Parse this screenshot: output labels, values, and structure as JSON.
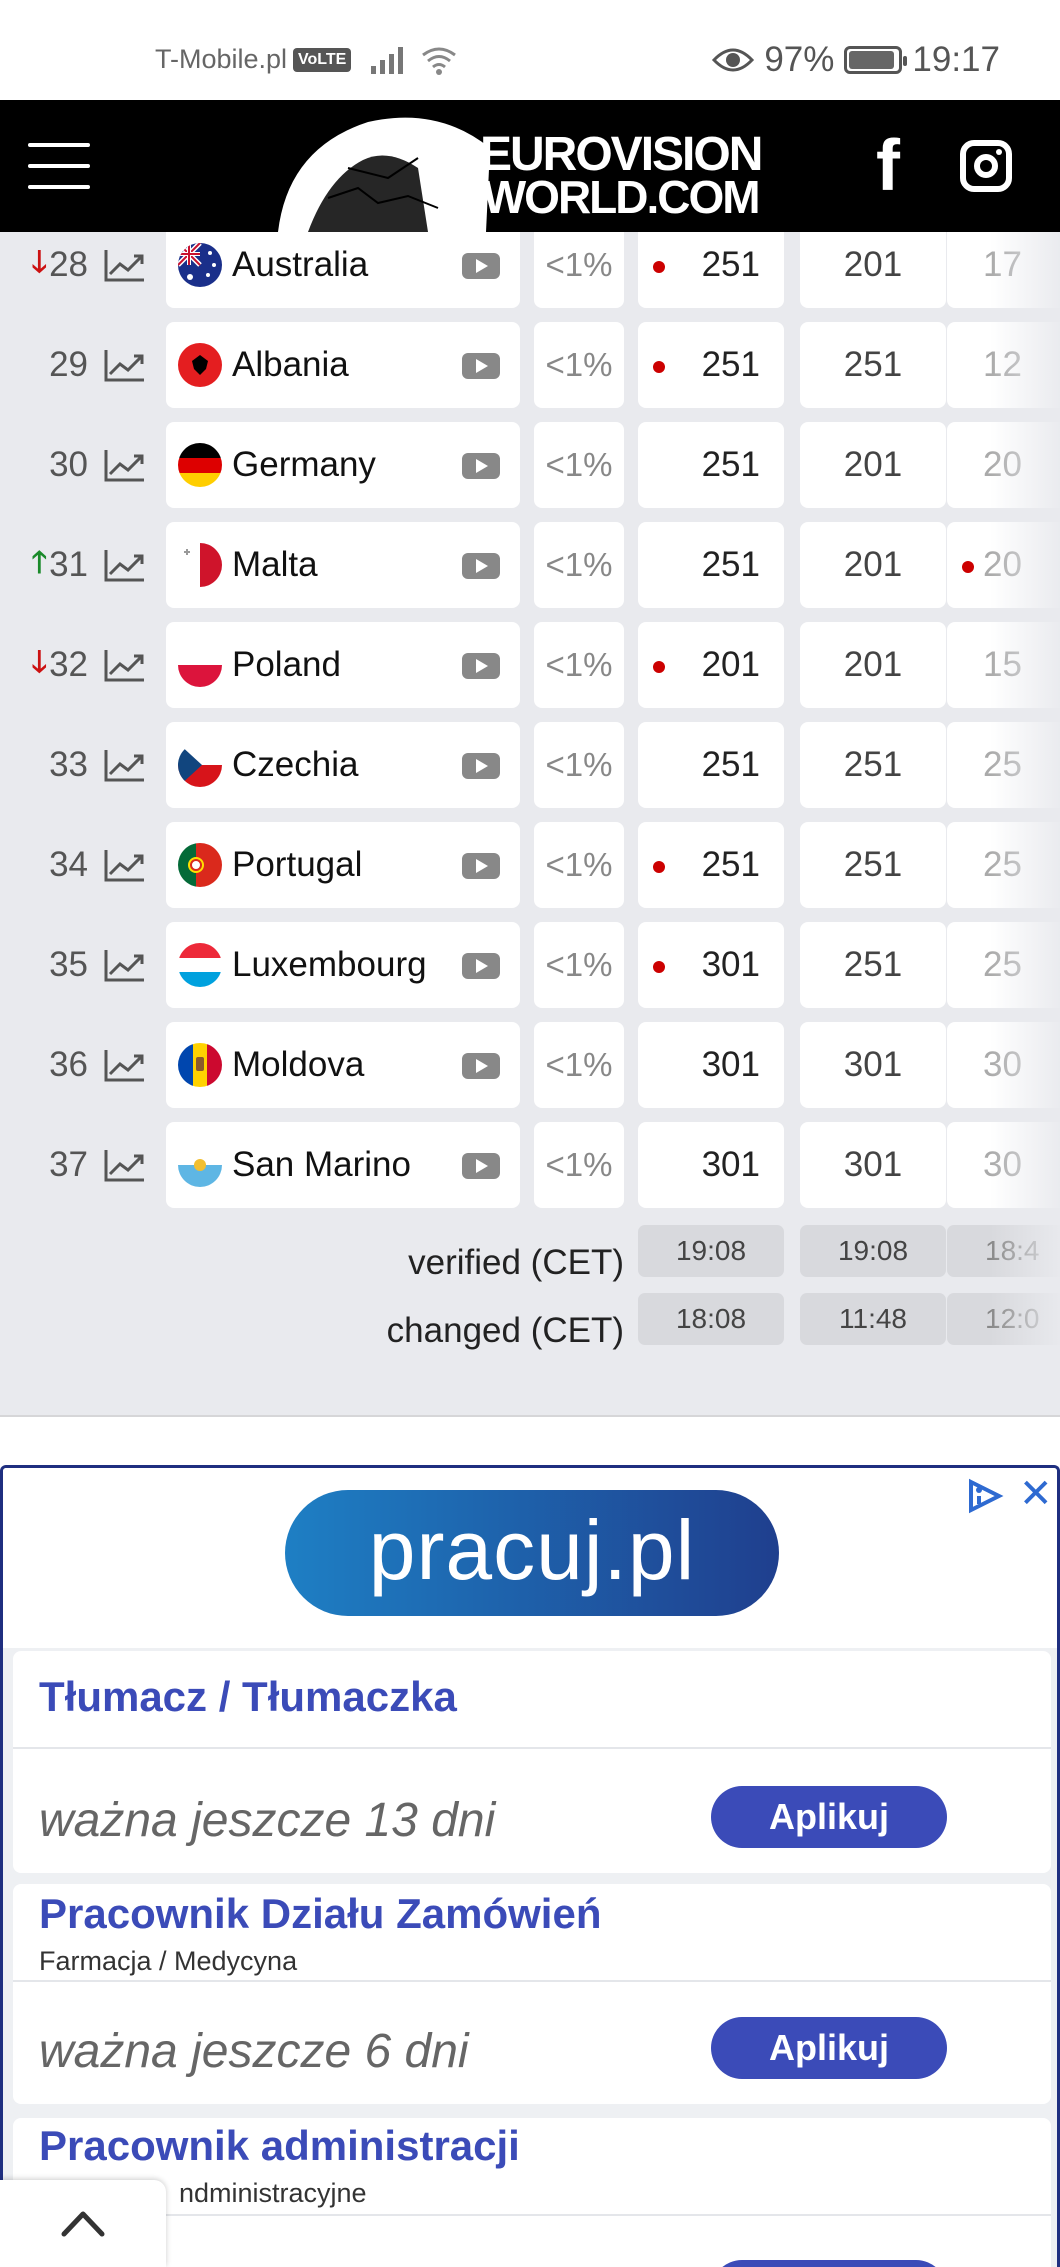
{
  "status_bar": {
    "carrier": "T-Mobile.pl",
    "volte": "VoLTE",
    "battery": "97%",
    "time": "19:17",
    "battery_level": 0.97
  },
  "header": {
    "logo_line1": "EUROVISION",
    "logo_line2": "WORLD.COM",
    "facebook_glyph": "f",
    "icons": [
      "hamburger-menu-icon",
      "facebook-icon",
      "instagram-icon"
    ]
  },
  "table": {
    "rows": [
      {
        "rank": "28",
        "arrow": "down",
        "country": "Australia",
        "pct": "<1%",
        "odds": [
          "251",
          "201",
          "17"
        ],
        "dots": [
          true,
          false,
          false
        ]
      },
      {
        "rank": "29",
        "arrow": "",
        "country": "Albania",
        "pct": "<1%",
        "odds": [
          "251",
          "251",
          "12"
        ],
        "dots": [
          true,
          false,
          false
        ]
      },
      {
        "rank": "30",
        "arrow": "",
        "country": "Germany",
        "pct": "<1%",
        "odds": [
          "251",
          "201",
          "20"
        ],
        "dots": [
          false,
          false,
          false
        ]
      },
      {
        "rank": "31",
        "arrow": "up",
        "country": "Malta",
        "pct": "<1%",
        "odds": [
          "251",
          "201",
          "20"
        ],
        "dots": [
          false,
          false,
          true
        ]
      },
      {
        "rank": "32",
        "arrow": "down",
        "country": "Poland",
        "pct": "<1%",
        "odds": [
          "201",
          "201",
          "15"
        ],
        "dots": [
          true,
          false,
          false
        ]
      },
      {
        "rank": "33",
        "arrow": "",
        "country": "Czechia",
        "pct": "<1%",
        "odds": [
          "251",
          "251",
          "25"
        ],
        "dots": [
          false,
          false,
          false
        ]
      },
      {
        "rank": "34",
        "arrow": "",
        "country": "Portugal",
        "pct": "<1%",
        "odds": [
          "251",
          "251",
          "25"
        ],
        "dots": [
          true,
          false,
          false
        ]
      },
      {
        "rank": "35",
        "arrow": "",
        "country": "Luxembourg",
        "pct": "<1%",
        "odds": [
          "301",
          "251",
          "25"
        ],
        "dots": [
          true,
          false,
          false
        ]
      },
      {
        "rank": "36",
        "arrow": "",
        "country": "Moldova",
        "pct": "<1%",
        "odds": [
          "301",
          "301",
          "30"
        ],
        "dots": [
          false,
          false,
          false
        ]
      },
      {
        "rank": "37",
        "arrow": "",
        "country": "San Marino",
        "pct": "<1%",
        "odds": [
          "301",
          "301",
          "30"
        ],
        "dots": [
          false,
          false,
          false
        ]
      }
    ],
    "verified_label": "verified (CET)",
    "verified": [
      "19:08",
      "19:08",
      "18:4"
    ],
    "changed_label": "changed (CET)",
    "changed": [
      "18:08",
      "11:48",
      "12:0"
    ]
  },
  "ad": {
    "brand": "pracuj.pl",
    "jobs": [
      {
        "title": "Tłumacz / Tłumaczka",
        "subtitle": "",
        "valid": "ważna jeszcze 13 dni",
        "button": "Aplikuj"
      },
      {
        "title": "Pracownik Działu Zamówień",
        "subtitle": "Farmacja / Medycyna",
        "valid": "ważna jeszcze 6 dni",
        "button": "Aplikuj"
      },
      {
        "title": "Pracownik administracji",
        "subtitle": "ndministracyjne",
        "valid": "",
        "button": ""
      }
    ],
    "close_glyph": "✕"
  },
  "colors": {
    "header_bg": "#000000",
    "table_bg": "#e9eaee",
    "ad_accent": "#3b4bb8",
    "down_arrow": "#cc1111",
    "up_arrow": "#1a8a2a",
    "dot": "#cc0000"
  }
}
